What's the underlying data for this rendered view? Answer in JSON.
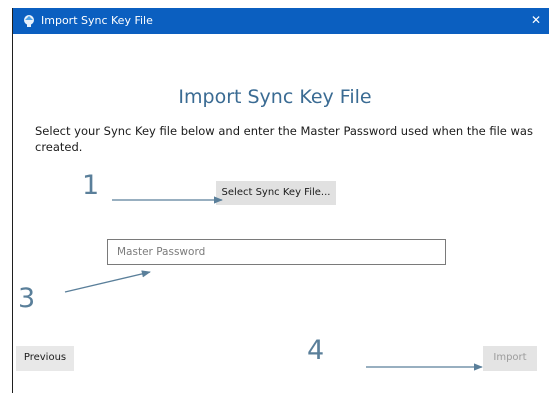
{
  "window": {
    "title": "Import Sync Key File",
    "close_glyph": "✕"
  },
  "main": {
    "heading": "Import Sync Key File",
    "instructions": "Select your Sync Key file below and enter the Master Password used when the file was created.",
    "select_button_label": "Select Sync Key File...",
    "password_placeholder": "Master Password",
    "password_value": ""
  },
  "footer": {
    "previous_label": "Previous",
    "import_label": "Import"
  },
  "annotations": {
    "step_1": "1",
    "step_3": "3",
    "step_4": "4"
  },
  "colors": {
    "titlebar": "#0b5fc0",
    "heading": "#3a6b93",
    "annotation": "#5a7f9a"
  },
  "icons": {
    "app_icon": "app-icon",
    "close_icon": "close-icon"
  }
}
